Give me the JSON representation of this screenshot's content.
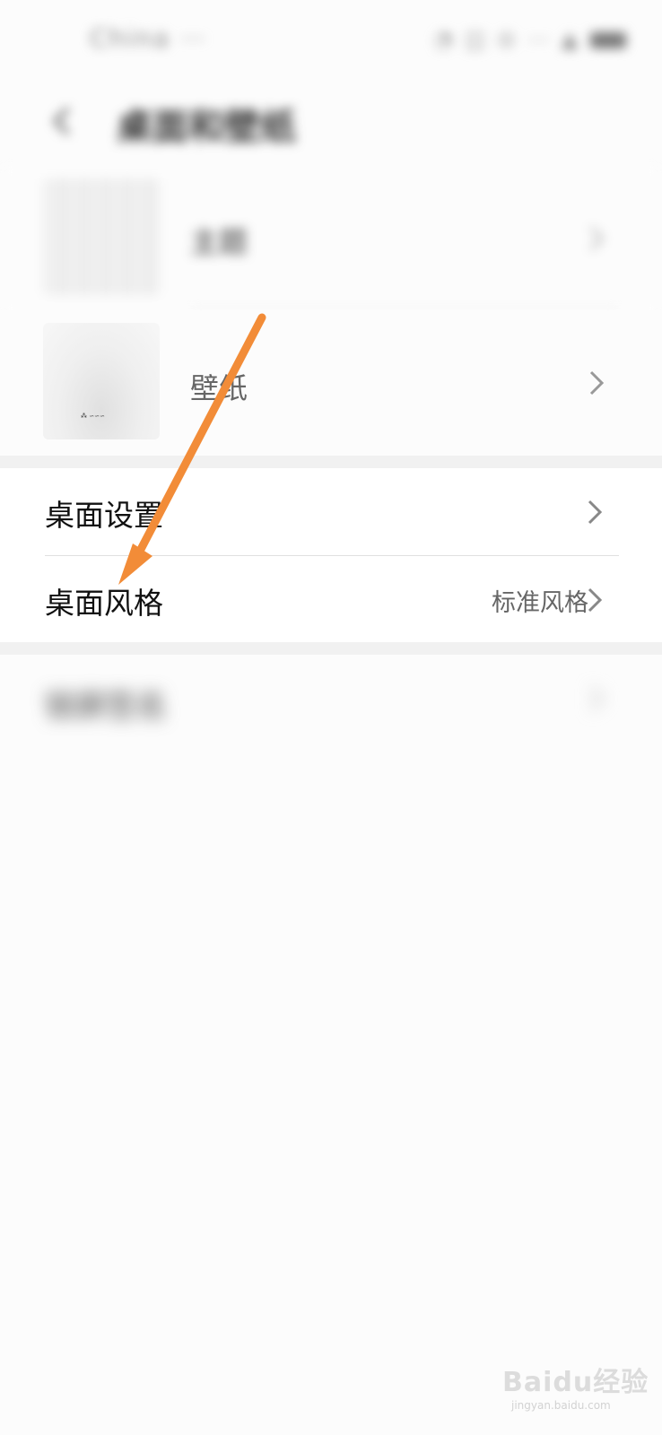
{
  "status_bar": {
    "carrier": "China ⋯",
    "icons": "◔ ◫ ⊙ ⋯ ▲"
  },
  "header": {
    "back_icon": "back-arrow-icon",
    "title": "桌面和壁纸"
  },
  "rows": {
    "theme": {
      "label": "主题"
    },
    "wallpaper": {
      "label": "壁纸"
    }
  },
  "settings": {
    "desktop_settings": {
      "label": "桌面设置"
    },
    "desktop_style": {
      "label": "桌面风格",
      "value": "标准风格"
    }
  },
  "lock_signature": {
    "label": "锁屏签名"
  },
  "annotation": {
    "arrow_color": "#f28c38"
  },
  "watermark": {
    "text": "Baidu经验",
    "url": "jingyan.baidu.com"
  },
  "colors": {
    "gap": "#f1f1f1",
    "card": "#ffffff",
    "text": "#111111",
    "secondary": "#666666"
  }
}
